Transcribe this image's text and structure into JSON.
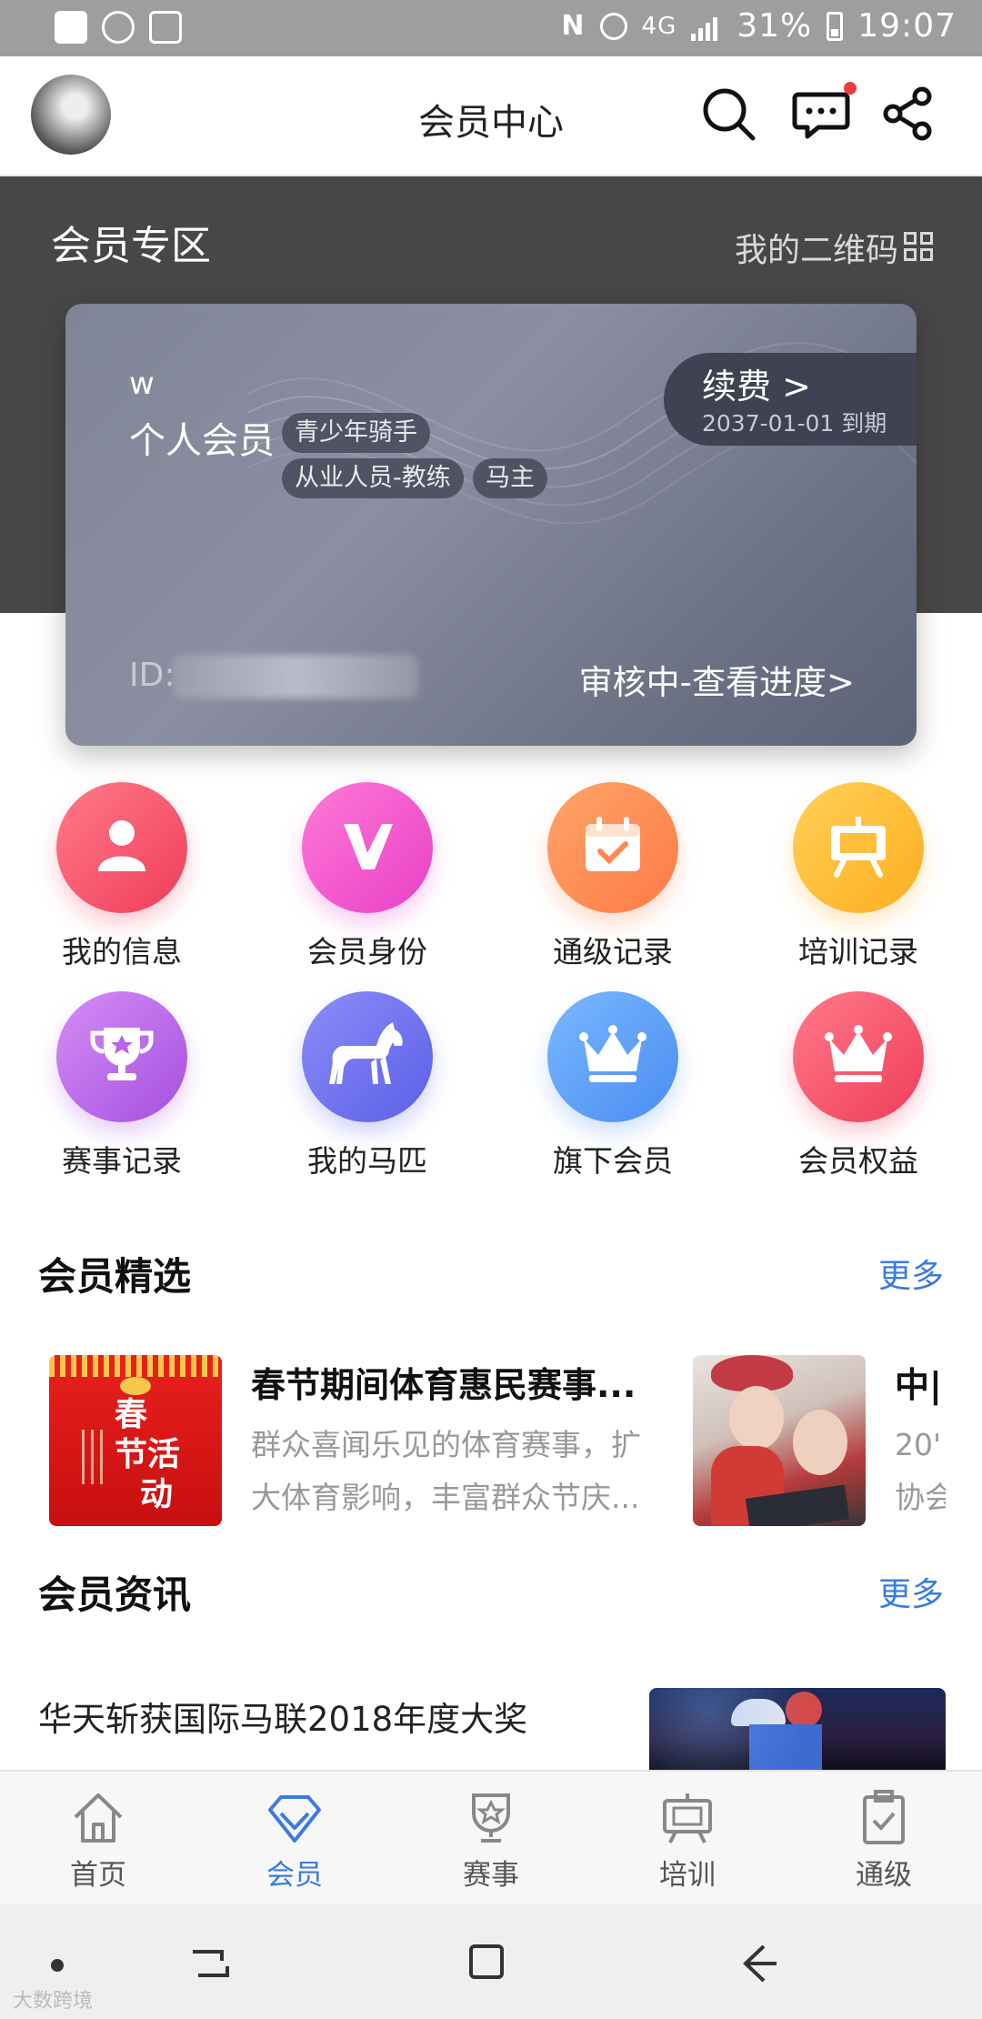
{
  "status_bar": {
    "network": "4G",
    "battery": "31%",
    "time": "19:07"
  },
  "header": {
    "title": "会员中心"
  },
  "zone": {
    "title": "会员专区",
    "qr_link": "我的二维码"
  },
  "card": {
    "name": "w",
    "member_type": "个人会员",
    "tags": [
      "青少年骑手",
      "从业人员-教练",
      "马主"
    ],
    "renew_label": "续费 >",
    "expiry": "2037-01-01 到期",
    "id_label": "ID:",
    "review_link": "审核中-查看进度>"
  },
  "grid": [
    {
      "label": "我的信息",
      "icon": "person-icon",
      "color_from": "#ff7a8a",
      "color_to": "#f03d5a"
    },
    {
      "label": "会员身份",
      "icon": "v-badge-icon",
      "color_from": "#ff7ad7",
      "color_to": "#e83fc6"
    },
    {
      "label": "通级记录",
      "icon": "calendar-check-icon",
      "color_from": "#ffa46a",
      "color_to": "#ff7a44"
    },
    {
      "label": "培训记录",
      "icon": "easel-icon",
      "color_from": "#ffd057",
      "color_to": "#ffad1f"
    },
    {
      "label": "赛事记录",
      "icon": "trophy-icon",
      "color_from": "#d58df5",
      "color_to": "#a54fe0"
    },
    {
      "label": "我的马匹",
      "icon": "horse-icon",
      "color_from": "#8b8df7",
      "color_to": "#5b5fe8"
    },
    {
      "label": "旗下会员",
      "icon": "crown-icon",
      "color_from": "#7ab8ff",
      "color_to": "#4a8df2"
    },
    {
      "label": "会员权益",
      "icon": "crown-icon",
      "color_from": "#ff7a8a",
      "color_to": "#f03d5a"
    }
  ],
  "featured": {
    "title": "会员精选",
    "more": "更多",
    "items": [
      {
        "title": "春节期间体育惠民赛事...",
        "desc_line1": "群众喜闻乐见的体育赛事，扩",
        "desc_line2": "大体育影响，丰富群众节庆...",
        "thumb_text_1": "春",
        "thumb_text_2": "节活",
        "thumb_text_3": "动"
      },
      {
        "title": "中|",
        "desc_line1": "20'",
        "desc_line2": "协会"
      }
    ]
  },
  "news": {
    "title": "会员资讯",
    "more": "更多",
    "items": [
      {
        "title": "华天斩获国际马联2018年度大奖"
      }
    ]
  },
  "tabs": [
    {
      "label": "首页",
      "icon": "home-icon",
      "active": false
    },
    {
      "label": "会员",
      "icon": "diamond-icon",
      "active": true
    },
    {
      "label": "赛事",
      "icon": "medal-icon",
      "active": false
    },
    {
      "label": "培训",
      "icon": "easel-icon",
      "active": false
    },
    {
      "label": "通级",
      "icon": "clipboard-check-icon",
      "active": false
    }
  ],
  "colors": {
    "accent": "#3b7be0",
    "zone_bg": "#474747",
    "notification": "#f03c3c"
  },
  "watermark": "大数跨境"
}
